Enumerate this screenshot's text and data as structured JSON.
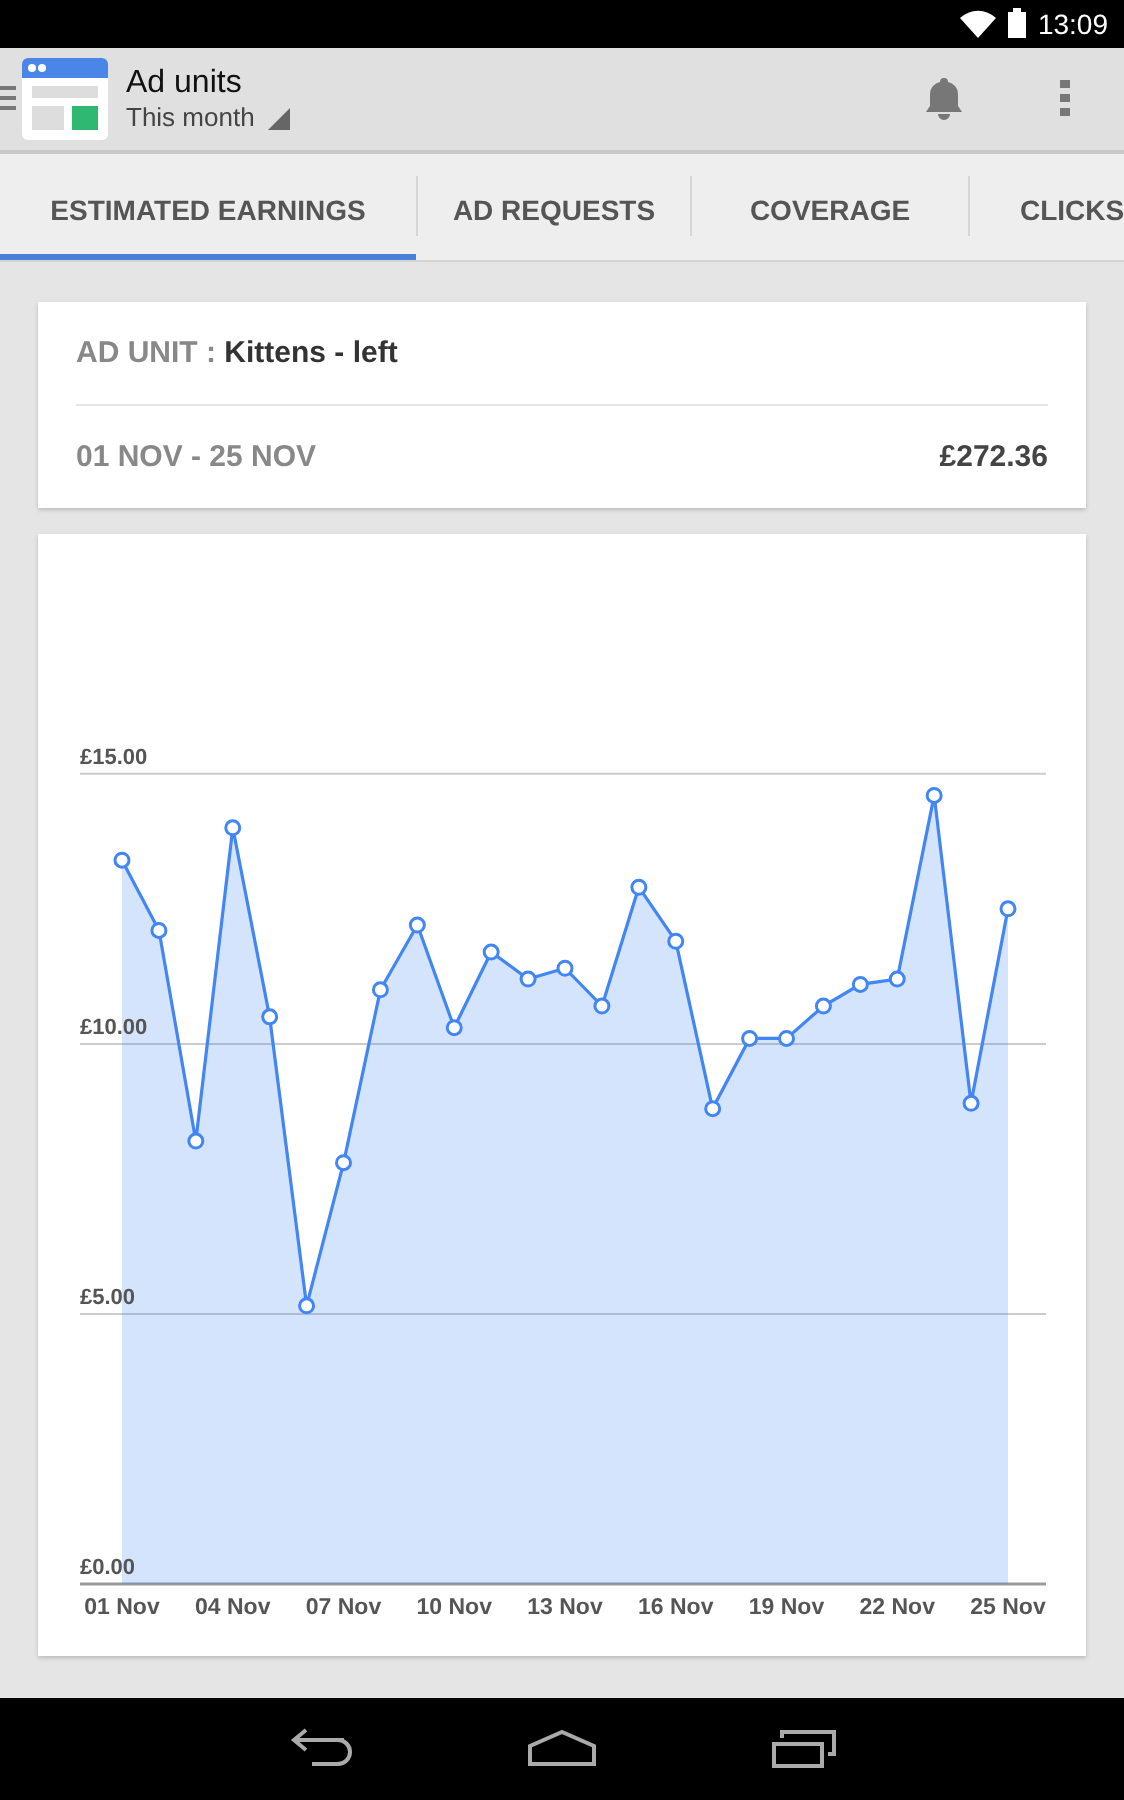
{
  "status_bar": {
    "time": "13:09"
  },
  "app_bar": {
    "title": "Ad units",
    "subtitle": "This month"
  },
  "tabs": [
    {
      "label": "ESTIMATED EARNINGS",
      "selected": true
    },
    {
      "label": "AD REQUESTS",
      "selected": false
    },
    {
      "label": "COVERAGE",
      "selected": false
    },
    {
      "label": "CLICKS",
      "selected": false
    }
  ],
  "summary": {
    "unit_label": "AD UNIT :",
    "unit_name": "Kittens - left",
    "date_range": "01 NOV - 25 NOV",
    "total": "£272.36"
  },
  "chart_data": {
    "type": "area",
    "categories": [
      "01 Nov",
      null,
      null,
      "04 Nov",
      null,
      null,
      "07 Nov",
      null,
      null,
      "10 Nov",
      null,
      null,
      "13 Nov",
      null,
      null,
      "16 Nov",
      null,
      null,
      "19 Nov",
      null,
      null,
      "22 Nov",
      null,
      null,
      "25 Nov"
    ],
    "series": [
      {
        "color": "#4285f4",
        "values": [
          13.4,
          12.1,
          8.2,
          14.0,
          10.5,
          5.15,
          7.8,
          11.0,
          12.2,
          10.3,
          11.7,
          11.2,
          11.4,
          10.7,
          12.9,
          11.9,
          8.8,
          10.1,
          10.1,
          10.7,
          11.1,
          11.2,
          14.6,
          8.9,
          12.5
        ]
      }
    ],
    "ylim": [
      0,
      19.44
    ],
    "grid": true,
    "yticks": [
      {
        "value": 0,
        "label": "£0.00"
      },
      {
        "value": 5,
        "label": "£5.00"
      },
      {
        "value": 10,
        "label": "£10.00"
      },
      {
        "value": 15,
        "label": "£15.00"
      }
    ]
  }
}
